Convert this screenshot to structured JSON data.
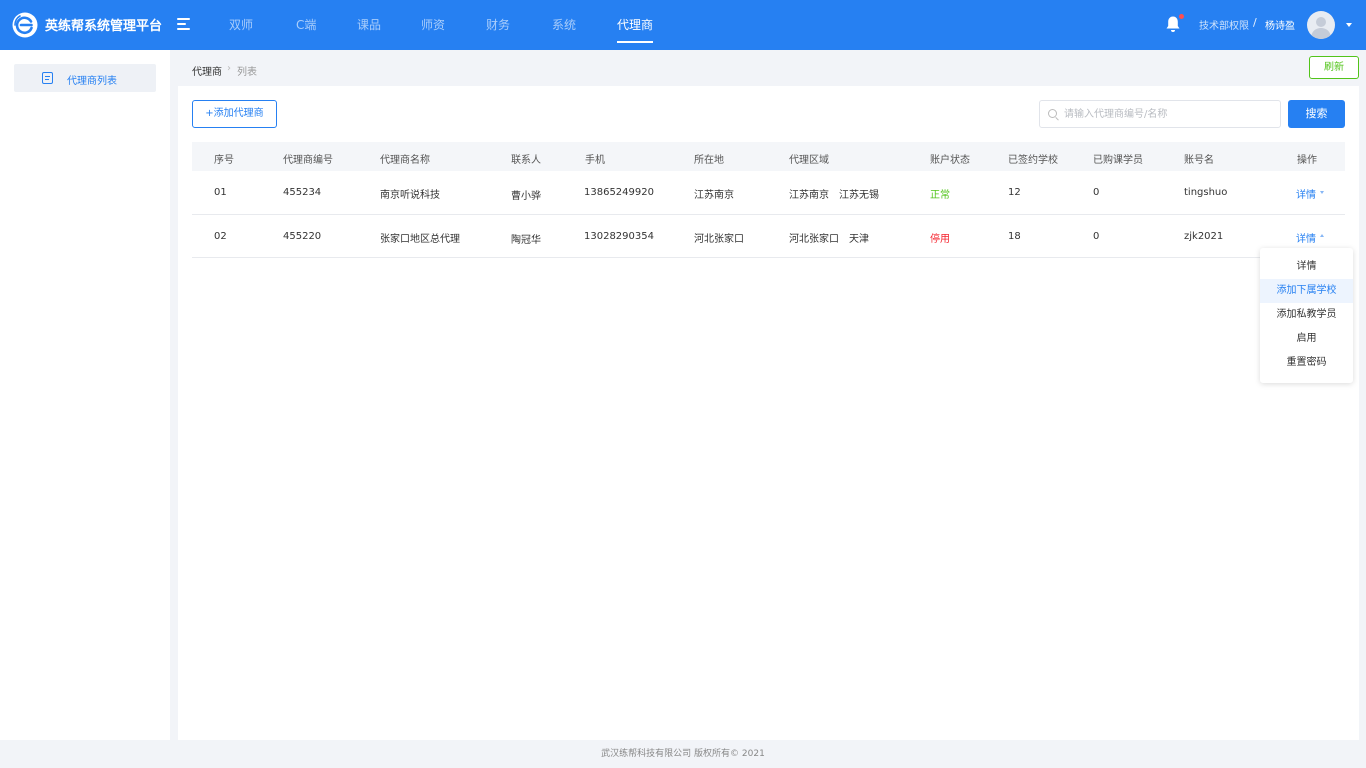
{
  "header": {
    "brand": "英练帮系统管理平台",
    "nav": [
      "双师",
      "C端",
      "课品",
      "师资",
      "财务",
      "系统",
      "代理商"
    ],
    "active_nav": "代理商",
    "department": "技术部权限",
    "separator": "/",
    "user_name": "杨诗盈"
  },
  "sidebar": {
    "items": [
      {
        "label": "代理商列表",
        "icon": "document-icon"
      }
    ]
  },
  "breadcrumb": {
    "items": [
      "代理商",
      "列表"
    ],
    "separator": "›"
  },
  "toolbar": {
    "refresh_label": "刷新",
    "add_label": "+添加代理商",
    "search_placeholder": "请输入代理商编号/名称",
    "search_label": "搜索"
  },
  "table": {
    "columns": [
      "序号",
      "代理商编号",
      "代理商名称",
      "联系人",
      "手机",
      "所在地",
      "代理区域",
      "账户状态",
      "已签约学校",
      "已购课学员",
      "账号名",
      "操作"
    ],
    "rows": [
      {
        "index": "01",
        "code": "455234",
        "name": "南京听说科技",
        "contact": "曹小骅",
        "phone": "13865249920",
        "location": "江苏南京",
        "region": "江苏南京　江苏无锡",
        "status": "正常",
        "schools": "12",
        "students": "0",
        "account": "tingshuo",
        "action": "详情"
      },
      {
        "index": "02",
        "code": "455220",
        "name": "张家口地区总代理",
        "contact": "陶冠华",
        "phone": "13028290354",
        "location": "河北张家口",
        "region": "河北张家口　天津",
        "status": "停用",
        "schools": "18",
        "students": "0",
        "account": "zjk2021",
        "action": "详情"
      }
    ]
  },
  "dropdown": {
    "items": [
      "详情",
      "添加下属学校",
      "添加私教学员",
      "启用",
      "重置密码"
    ],
    "highlighted": "添加下属学校"
  },
  "footer": {
    "copyright": "武汉练帮科技有限公司 版权所有© 2021"
  },
  "colors": {
    "primary": "#2680f2",
    "success": "#52c41a",
    "danger": "#f5222d"
  }
}
